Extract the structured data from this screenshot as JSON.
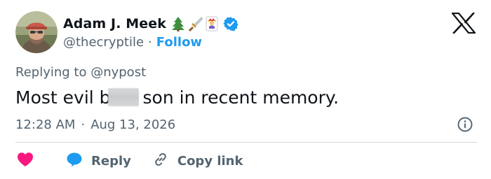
{
  "author": {
    "display_name": "Adam J. Meek",
    "handle": "@thecryptile",
    "separator": "·",
    "follow_label": "Follow",
    "name_emojis": [
      "tree-emoji",
      "dagger-emoji",
      "joker-card-emoji"
    ],
    "verified": true
  },
  "tweet": {
    "replying_to": "Replying to @nypost",
    "text_before": "Most evil b",
    "text_after": "son in recent memory.",
    "time": "12:28 AM",
    "separator": "·",
    "date": "Aug 13, 2026"
  },
  "actions": {
    "reply_label": "Reply",
    "copy_link_label": "Copy link"
  },
  "colors": {
    "text_primary": "#0f1419",
    "text_secondary": "#536471",
    "accent": "#1d9bf0",
    "like": "#f91880",
    "divider": "#cfd9de"
  },
  "icons": {
    "brand": "x-logo-icon",
    "verified": "verified-badge-icon",
    "info": "info-icon",
    "like": "heart-icon",
    "reply": "speech-bubble-icon",
    "copy_link": "link-icon"
  }
}
